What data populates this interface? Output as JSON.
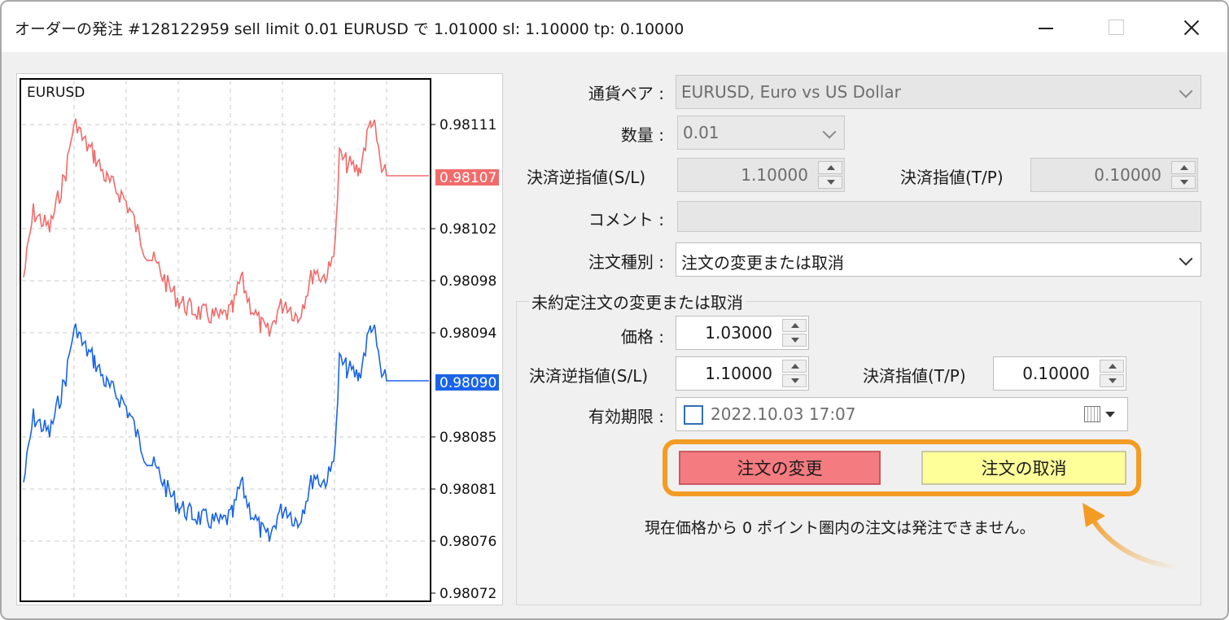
{
  "window": {
    "title": "オーダーの発注 #128122959 sell limit 0.01 EURUSD で 1.01000 sl: 1.10000 tp: 0.10000"
  },
  "chart": {
    "symbol": "EURUSD",
    "price_labels": [
      "0.98111",
      "0.98102",
      "0.98098",
      "0.98094",
      "0.98085",
      "0.98081",
      "0.98076",
      "0.98072"
    ],
    "ask_label": "0.98107",
    "bid_label": "0.98090",
    "ask_color": "#f26b6b",
    "bid_color": "#1a64e8"
  },
  "form": {
    "symbol_label": "通貨ペア :",
    "symbol_value": "EURUSD, Euro vs US Dollar",
    "volume_label": "数量 :",
    "volume_value": "0.01",
    "sl_label": "決済逆指値(S/L)",
    "sl_value": "1.10000",
    "tp_label": "決済指値(T/P)",
    "tp_value": "0.10000",
    "comment_label": "コメント :",
    "comment_value": "",
    "type_label": "注文種別 :",
    "type_value": "注文の変更または取消"
  },
  "pending": {
    "group_title": "未約定注文の変更または取消",
    "price_label": "価格 :",
    "price_value": "1.03000",
    "sl_label": "決済逆指値(S/L)",
    "sl_value": "1.10000",
    "tp_label": "決済指値(T/P)",
    "tp_value": "0.10000",
    "expiry_label": "有効期限 :",
    "expiry_value": "2022.10.03 17:07",
    "modify_button": "注文の変更",
    "cancel_button": "注文の取消",
    "status_message": "現在価格から 0 ポイント圏内の注文は発注できません。",
    "highlight_color": "#f29c25"
  }
}
